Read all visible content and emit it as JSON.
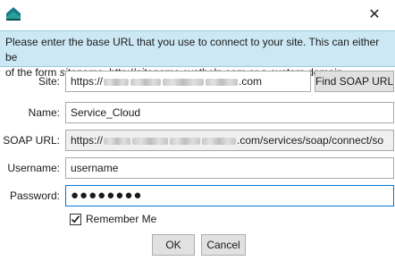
{
  "window": {
    "close_glyph": "✕",
    "app_icon": "app-logo-icon"
  },
  "banner": {
    "line1": "Please enter the base URL that you use to connect to your site. This can either be",
    "line2_prefix": "of the form ",
    "line2_italic1": "sitename",
    "line2_mid": ", http://",
    "line2_italic2": "sitename",
    "line2_suffix": ".custhelp.com or a custom domain."
  },
  "form": {
    "site_label": "Site:",
    "site_value_prefix": "https://",
    "site_value_suffix": ".com",
    "find_soap_label": "Find SOAP URL",
    "name_label": "Name:",
    "name_value": "Service_Cloud",
    "soap_label": "SOAP URL:",
    "soap_value_prefix": "https://",
    "soap_value_suffix": ".com/services/soap/connect/so",
    "username_label": "Username:",
    "username_value": "username",
    "password_label": "Password:",
    "password_value": "●●●●●●●●",
    "remember_label": "Remember Me",
    "remember_checked": true
  },
  "buttons": {
    "ok": "OK",
    "cancel": "Cancel"
  },
  "colors": {
    "banner_bg": "#cde8f5",
    "focus_border": "#0078d7"
  }
}
